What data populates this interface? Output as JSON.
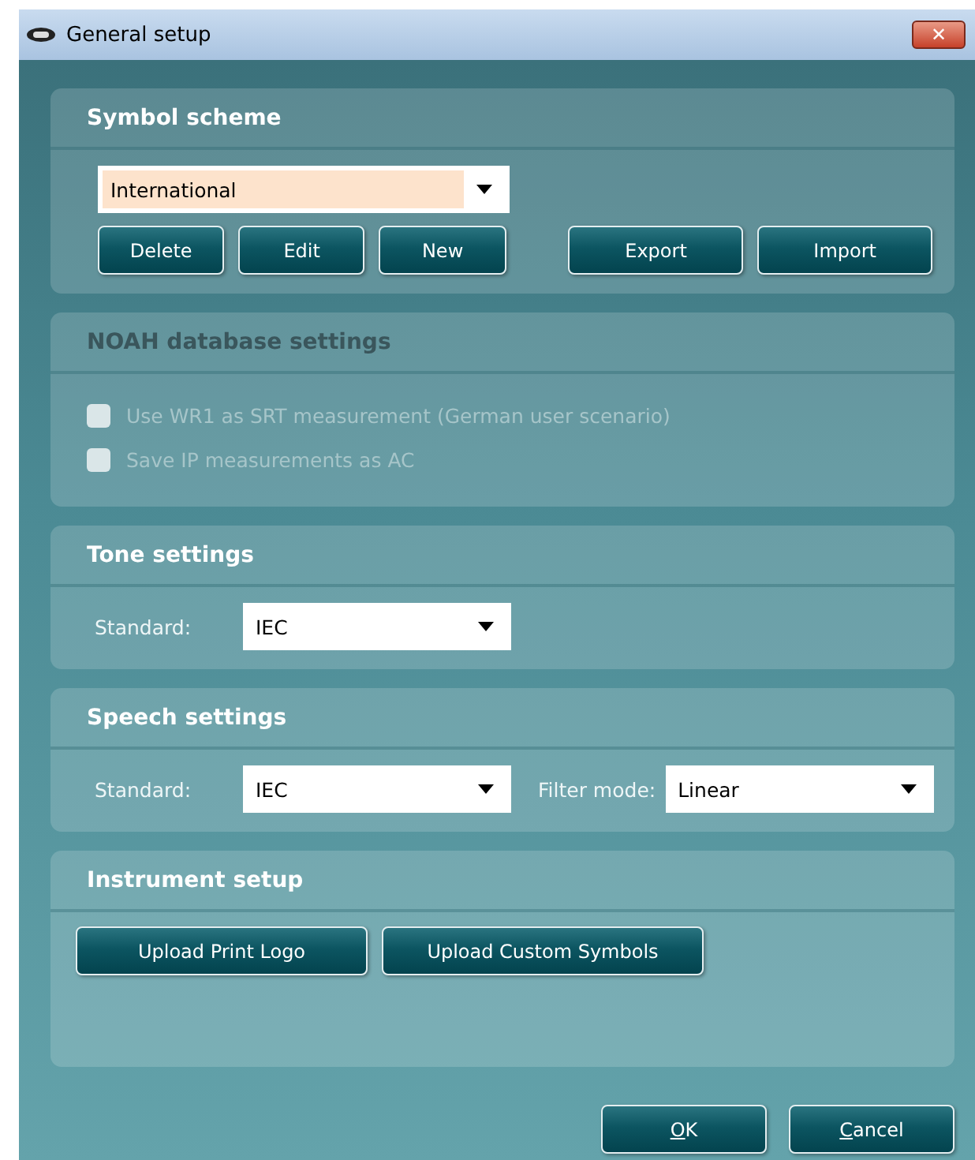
{
  "window": {
    "title": "General setup",
    "close": "✕"
  },
  "sections": [
    {
      "kind": "scheme",
      "title": "Symbol scheme",
      "disabled": false,
      "select": {
        "value": "International",
        "highlighted": true
      },
      "buttons": [
        {
          "label": "Delete"
        },
        {
          "label": "Edit"
        },
        {
          "label": "New"
        }
      ],
      "buttons_right": [
        {
          "label": "Export"
        },
        {
          "label": "Import"
        }
      ]
    },
    {
      "kind": "checks",
      "title": "NOAH database settings",
      "disabled": true,
      "options": [
        {
          "label": "Use WR1 as SRT measurement (German user scenario)",
          "checked": false
        },
        {
          "label": "Save IP measurements as AC",
          "checked": false
        }
      ]
    },
    {
      "kind": "fields",
      "title": "Tone settings",
      "disabled": false,
      "fields": [
        {
          "label": "Standard:",
          "value": "IEC"
        }
      ]
    },
    {
      "kind": "fields",
      "title": "Speech settings",
      "disabled": false,
      "fields": [
        {
          "label": "Standard:",
          "value": "IEC"
        },
        {
          "label": "Filter mode:",
          "value": "Linear"
        }
      ]
    },
    {
      "kind": "uploads",
      "title": "Instrument setup",
      "disabled": false,
      "buttons": [
        {
          "label": "Upload Print Logo"
        },
        {
          "label": "Upload Custom Symbols"
        }
      ]
    }
  ],
  "footer": {
    "buttons": [
      {
        "label": "OK",
        "underline_first": true
      },
      {
        "label": "Cancel",
        "underline_first": true
      }
    ]
  }
}
